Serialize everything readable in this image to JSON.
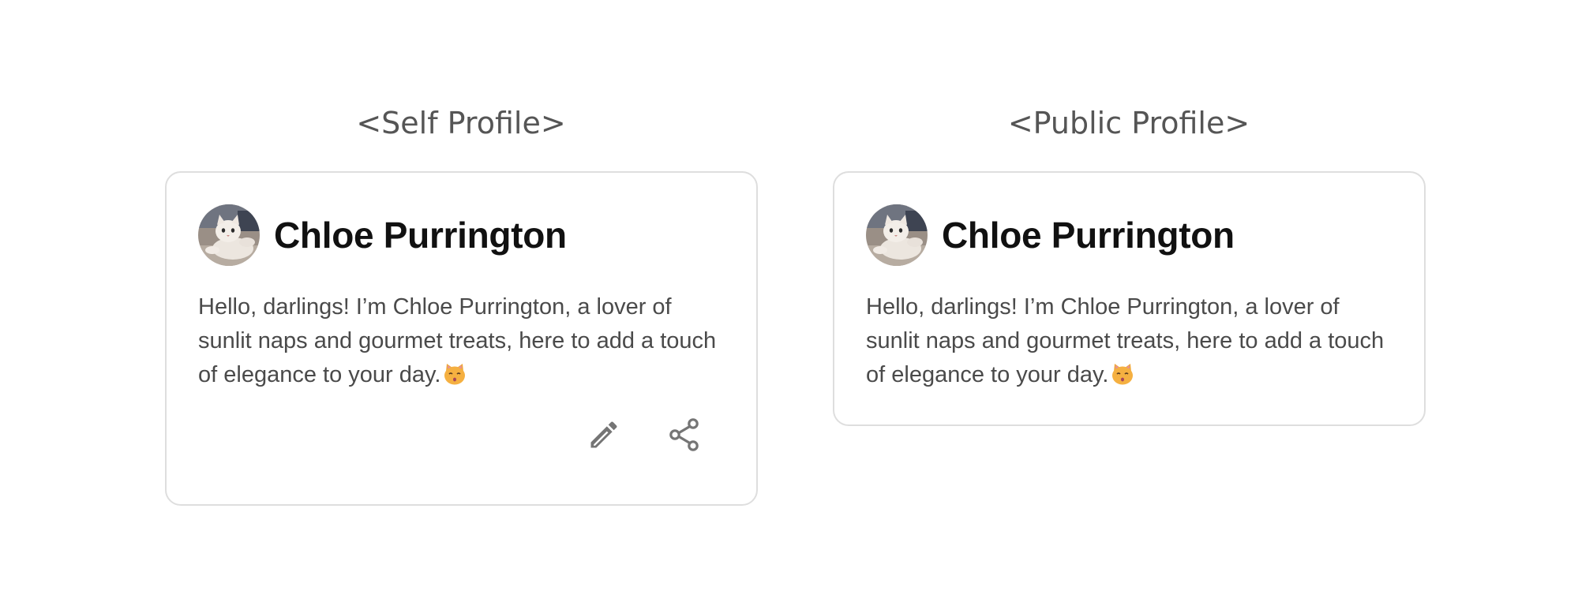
{
  "sections": {
    "self": {
      "title": "<Self Profile>",
      "card": {
        "name": "Chloe Purrington",
        "bio": "Hello, darlings! I’m Chloe Purrington, a lover of sunlit naps and gourmet treats, here to add a touch of elegance to your day.",
        "emoji": "kissing-cat-emoji",
        "actions": [
          "pencil-icon",
          "share-icon"
        ]
      }
    },
    "public": {
      "title": "<Public Profile>",
      "card": {
        "name": "Chloe Purrington",
        "bio": "Hello, darlings! I’m Chloe Purrington, a lover of sunlit naps and gourmet treats, here to add a touch of elegance to your day.",
        "emoji": "kissing-cat-emoji"
      }
    }
  },
  "colors": {
    "title_text": "#555555",
    "name_text": "#111111",
    "bio_text": "#4a4a4a",
    "icon": "#757575",
    "card_border": "#dedede"
  }
}
